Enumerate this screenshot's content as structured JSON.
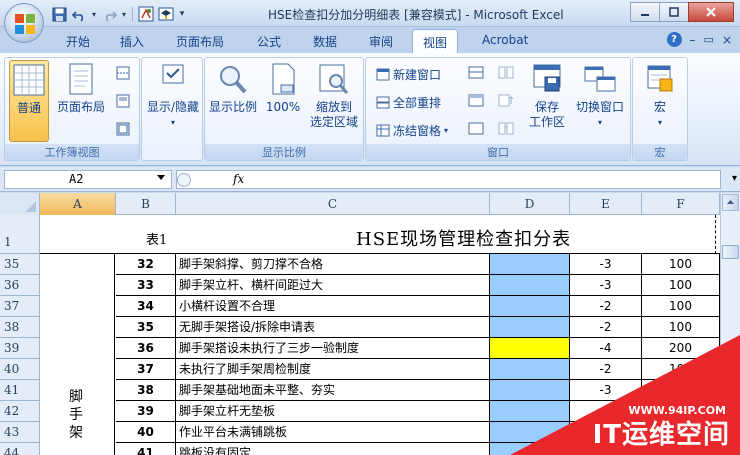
{
  "window": {
    "title": "HSE检查扣分加分明细表  [兼容模式] - Microsoft Excel"
  },
  "ribbon_tabs": [
    "开始",
    "插入",
    "页面布局",
    "公式",
    "数据",
    "审阅",
    "视图",
    "Acrobat"
  ],
  "active_tab": "视图",
  "ribbon": {
    "workbook_views": {
      "label": "工作簿视图",
      "normal": "普通",
      "page_layout": "页面布局"
    },
    "show_hide": {
      "label": "显示/隐藏"
    },
    "zoom": {
      "label": "显示比例",
      "zoom": "显示比例",
      "hundred": "100%",
      "zoom_to_selection_line1": "缩放到",
      "zoom_to_selection_line2": "选定区域"
    },
    "window": {
      "label": "窗口",
      "new_window": "新建窗口",
      "arrange_all": "全部重排",
      "freeze_panes": "冻结窗格",
      "save_workspace_line1": "保存",
      "save_workspace_line2": "工作区",
      "switch_windows": "切换窗口"
    },
    "macros": {
      "label": "宏",
      "macro": "宏"
    }
  },
  "formula_bar": {
    "name_box": "A2",
    "fx": "fx",
    "formula": ""
  },
  "columns": [
    "A",
    "B",
    "C",
    "D",
    "E",
    "F"
  ],
  "selected_column": "A",
  "sheet": {
    "header_row": "1",
    "table_label": "表1",
    "title": "HSE现场管理检查扣分表",
    "category": "脚手架",
    "rows": [
      {
        "row": "35",
        "no": "32",
        "item": "脚手架斜撑、剪刀撑不合格",
        "score": "-3",
        "total": "100"
      },
      {
        "row": "36",
        "no": "33",
        "item": "脚手架立杆、横杆间距过大",
        "score": "-3",
        "total": "100"
      },
      {
        "row": "37",
        "no": "34",
        "item": "小横杆设置不合理",
        "score": "-2",
        "total": "100"
      },
      {
        "row": "38",
        "no": "35",
        "item": "无脚手架搭设/拆除申请表",
        "score": "-2",
        "total": "100"
      },
      {
        "row": "39",
        "no": "36",
        "item": "脚手架搭设未执行了三步一验制度",
        "score": "-4",
        "total": "200"
      },
      {
        "row": "40",
        "no": "37",
        "item": "未执行了脚手架周检制度",
        "score": "-2",
        "total": "100"
      },
      {
        "row": "41",
        "no": "38",
        "item": "脚手架基础地面未平整、夯实",
        "score": "-3",
        "total": ""
      },
      {
        "row": "42",
        "no": "39",
        "item": "脚手架立杆无垫板",
        "score": "",
        "total": ""
      },
      {
        "row": "43",
        "no": "40",
        "item": "作业平台未满铺跳板",
        "score": "",
        "total": ""
      },
      {
        "row": "44",
        "no": "41",
        "item": "跳板没有固定",
        "score": "",
        "total": ""
      }
    ]
  },
  "colors": {
    "cell_blue": "#99ccff",
    "cell_yellow": "#ffff00",
    "watermark_red": "#e8282a"
  },
  "watermark": {
    "url": "WWW.94IP.COM",
    "name": "IT运维空间"
  }
}
